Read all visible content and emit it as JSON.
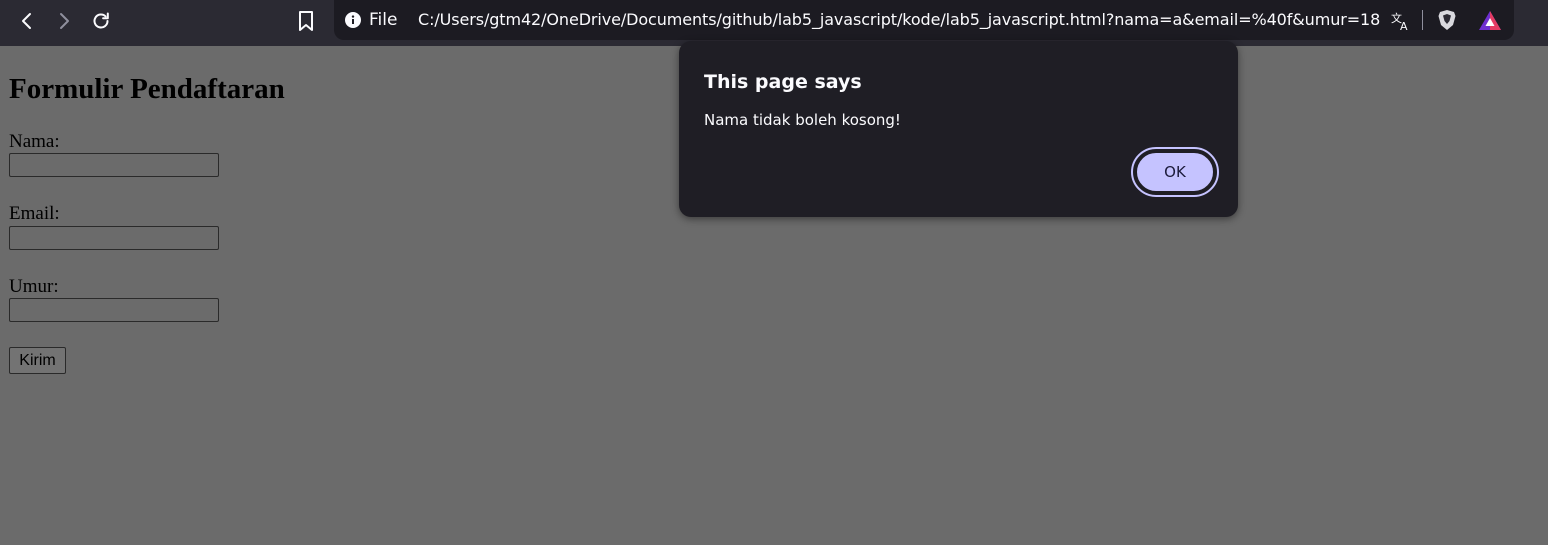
{
  "browser": {
    "back_icon": "chevron-left-icon",
    "forward_icon": "chevron-right-icon",
    "reload_icon": "reload-icon",
    "bookmark_icon": "bookmark-icon",
    "address_bar": {
      "info_icon": "info-icon",
      "scheme_label": "File",
      "url": "C:/Users/gtm42/OneDrive/Documents/github/lab5_javascript/kode/lab5_javascript.html?nama=a&email=%40f&umur=18",
      "translate_icon": "translate-icon",
      "shield_icon": "brave-shield-icon",
      "rewards_icon": "brave-rewards-icon"
    }
  },
  "page": {
    "title": "Formulir Pendaftaran",
    "fields": [
      {
        "label": "Nama:",
        "value": ""
      },
      {
        "label": "Email:",
        "value": ""
      },
      {
        "label": "Umur:",
        "value": ""
      }
    ],
    "submit_label": "Kirim"
  },
  "alert": {
    "title": "This page says",
    "message": "Nama tidak boleh kosong!",
    "ok_label": "OK"
  },
  "colors": {
    "toolbar_bg": "#2b2a33",
    "dim_page_bg": "#6b6b6b",
    "dialog_bg": "#1f1e25",
    "ok_button": "#c5c3ff"
  }
}
